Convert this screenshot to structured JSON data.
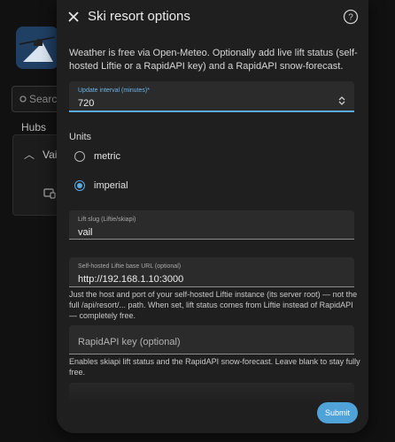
{
  "background": {
    "search_placeholder": "Search",
    "hubs_label": "Hubs",
    "item_label": "Vail"
  },
  "dialog": {
    "title": "Ski resort options",
    "intro": "Weather is free via Open-Meteo. Optionally add live lift status (self-hosted Liftie or a RapidAPI key) and a RapidAPI snow-forecast.",
    "update_interval": {
      "label": "Update interval (minutes)*",
      "value": "720"
    },
    "units": {
      "label": "Units",
      "options": [
        {
          "label": "metric",
          "selected": false
        },
        {
          "label": "imperial",
          "selected": true
        }
      ]
    },
    "lift_slug": {
      "label": "Lift slug (Liftie/skiapi)",
      "value": "vail"
    },
    "liftie_url": {
      "label": "Self-hosted Liftie base URL (optional)",
      "value": "http://192.168.1.10:3000",
      "helper": "Just the host and port of your self-hosted Liftie instance (its server root) — not the full /api/resort/... path. When set, lift status comes from Liftie instead of RapidAPI — completely free."
    },
    "rapidapi_key": {
      "placeholder": "RapidAPI key (optional)",
      "helper": "Enables skiapi lift status and the RapidAPI snow-forecast. Leave blank to stay fully free."
    },
    "submit_label": "Submit"
  },
  "colors": {
    "accent": "#5cabe0",
    "button": "#4fa3d8",
    "dialog_bg": "#1f1f1f",
    "field_bg": "#2b2b2b"
  }
}
